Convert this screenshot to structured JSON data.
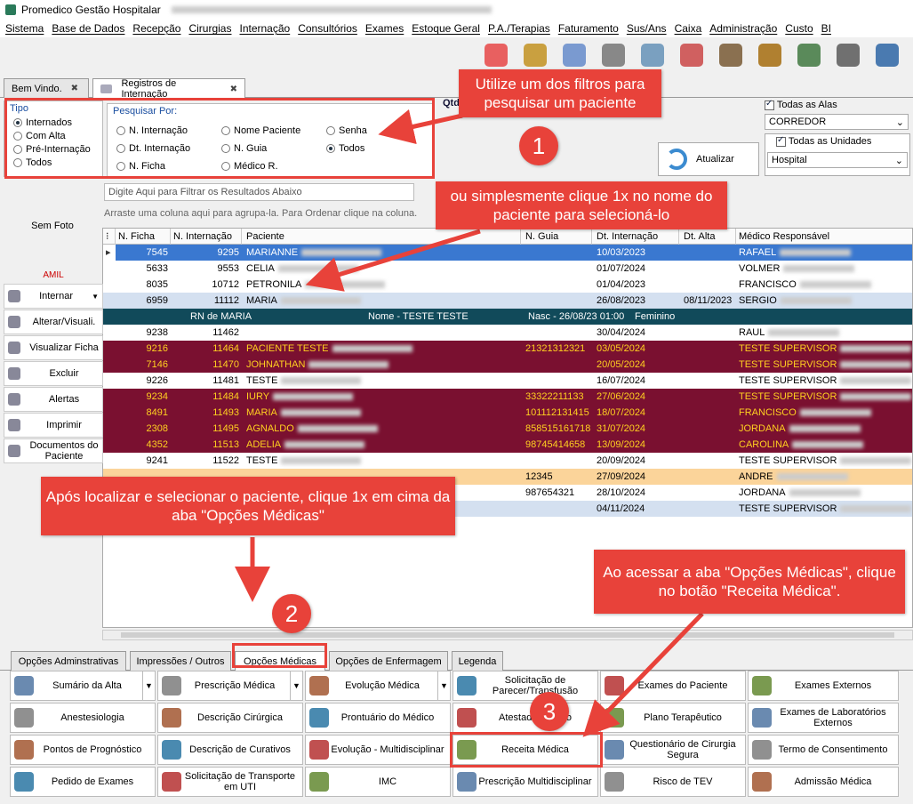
{
  "window": {
    "title": "Promedico Gestão Hospitalar"
  },
  "menu": [
    "Sistema",
    "Base de Dados",
    "Recepção",
    "Cirurgias",
    "Internação",
    "Consultórios",
    "Exames",
    "Estoque Geral",
    "P.A./Terapias",
    "Faturamento",
    "Sus/Ans",
    "Caixa",
    "Administração",
    "Custo",
    "BI"
  ],
  "toolbar_icons": [
    "users-icon",
    "reception-icon",
    "doctor-icon",
    "stethoscope-icon",
    "ambulance-icon",
    "ambulance2-icon",
    "tools-icon",
    "boxes-icon",
    "money-icon",
    "safe-icon",
    "exit-icon"
  ],
  "doc_tabs": [
    "Bem Vindo.",
    "Registros de Internação"
  ],
  "tipo": {
    "title": "Tipo",
    "options": [
      "Internados",
      "Com Alta",
      "Pré-Internação",
      "Todos"
    ],
    "selected": 0
  },
  "pesquisar": {
    "title": "Pesquisar Por:",
    "options": [
      "N. Internação",
      "Nome Paciente",
      "Senha",
      "Dt. Internação",
      "N. Guia",
      "Todos",
      "N. Ficha",
      "Médico R."
    ],
    "selected": "Todos"
  },
  "qtd_label": "Qtd",
  "alas": {
    "checkbox_label": "Todas as Alas",
    "ala_value": "CORREDOR",
    "unidades_label": "Todas as Unidades",
    "unidade_value": "Hospital"
  },
  "atualizar_label": "Atualizar",
  "photo_label": "Sem Foto",
  "filter_placeholder": "Digite Aqui para Filtrar os Resultados Abaixo",
  "grouping_hint": "Arraste uma coluna aqui para agrupa-la. Para Ordenar clique na coluna.",
  "columns": [
    "N. Ficha",
    "N. Internação",
    "Paciente",
    "N. Guia",
    "Dt. Internação",
    "Dt. Alta",
    "Médico Responsável"
  ],
  "rows": [
    {
      "ficha": "7545",
      "intern": "9295",
      "paciente": "MARIANNE",
      "guia": "",
      "dt": "10/03/2023",
      "alta": "",
      "medico": "RAFAEL",
      "style": "sel"
    },
    {
      "ficha": "5633",
      "intern": "9553",
      "paciente": "CELIA",
      "guia": "",
      "dt": "01/07/2024",
      "alta": "",
      "medico": "VOLMER",
      "style": "plain"
    },
    {
      "ficha": "8035",
      "intern": "10712",
      "paciente": "PETRONILA",
      "guia": "",
      "dt": "01/04/2023",
      "alta": "",
      "medico": "FRANCISCO",
      "style": "plain"
    },
    {
      "ficha": "6959",
      "intern": "11112",
      "paciente": "MARIA",
      "guia": "",
      "dt": "26/08/2023",
      "alta": "08/11/2023",
      "medico": "SERGIO",
      "style": "light"
    },
    {
      "ficha": "",
      "intern": "",
      "paciente": "",
      "guia": "",
      "dt": "",
      "alta": "",
      "medico": "",
      "style": "sub",
      "sub": {
        "rn": "RN de MARIA",
        "nome": "Nome - TESTE TESTE",
        "nasc": "Nasc - 26/08/23 01:00",
        "sexo": "Feminino"
      }
    },
    {
      "ficha": "9238",
      "intern": "11462",
      "paciente": "",
      "guia": "",
      "dt": "30/04/2024",
      "alta": "",
      "medico": "RAUL",
      "style": "plain"
    },
    {
      "ficha": "9216",
      "intern": "11464",
      "paciente": "PACIENTE TESTE",
      "guia": "21321312321",
      "dt": "03/05/2024",
      "alta": "",
      "medico": "TESTE SUPERVISOR",
      "style": "dark"
    },
    {
      "ficha": "7146",
      "intern": "11470",
      "paciente": "JOHNATHAN",
      "guia": "",
      "dt": "20/05/2024",
      "alta": "",
      "medico": "TESTE SUPERVISOR",
      "style": "dark"
    },
    {
      "ficha": "9226",
      "intern": "11481",
      "paciente": "TESTE",
      "guia": "",
      "dt": "16/07/2024",
      "alta": "",
      "medico": "TESTE SUPERVISOR",
      "style": "plain"
    },
    {
      "ficha": "9234",
      "intern": "11484",
      "paciente": "IURY",
      "guia": "33322211133",
      "dt": "27/06/2024",
      "alta": "",
      "medico": "TESTE SUPERVISOR",
      "style": "dark"
    },
    {
      "ficha": "8491",
      "intern": "11493",
      "paciente": "MARIA",
      "guia": "101112131415",
      "dt": "18/07/2024",
      "alta": "",
      "medico": "FRANCISCO",
      "style": "dark"
    },
    {
      "ficha": "2308",
      "intern": "11495",
      "paciente": "AGNALDO",
      "guia": "858515161718",
      "dt": "31/07/2024",
      "alta": "",
      "medico": "JORDANA",
      "style": "dark"
    },
    {
      "ficha": "4352",
      "intern": "11513",
      "paciente": "ADELIA",
      "guia": "98745414658",
      "dt": "13/09/2024",
      "alta": "",
      "medico": "CAROLINA",
      "style": "dark"
    },
    {
      "ficha": "9241",
      "intern": "11522",
      "paciente": "TESTE",
      "guia": "",
      "dt": "20/09/2024",
      "alta": "",
      "medico": "TESTE SUPERVISOR",
      "style": "plain"
    },
    {
      "ficha": "",
      "intern": "",
      "paciente": "",
      "guia": "12345",
      "dt": "27/09/2024",
      "alta": "",
      "medico": "ANDRE",
      "style": "orange"
    },
    {
      "ficha": "",
      "intern": "",
      "paciente": "",
      "guia": "987654321",
      "dt": "28/10/2024",
      "alta": "",
      "medico": "JORDANA",
      "style": "plain"
    },
    {
      "ficha": "",
      "intern": "",
      "paciente": "",
      "guia": "",
      "dt": "04/11/2024",
      "alta": "",
      "medico": "TESTE SUPERVISOR",
      "style": "light"
    }
  ],
  "left_tools": {
    "title": "AMIL",
    "buttons": [
      "Internar",
      "Alterar/Visuali.",
      "Visualizar Ficha",
      "Excluir",
      "Alertas",
      "Imprimir",
      "Documentos do Paciente"
    ]
  },
  "option_tabs": [
    "Opções Adminstrativas",
    "Impressões / Outros",
    "Opções Médicas",
    "Opções de Enfermagem",
    "Legenda"
  ],
  "option_buttons": [
    [
      "Sumário da Alta",
      "Prescrição Médica",
      "Evolução Médica",
      "Solicitação de Parecer/Transfusão",
      "Exames do Paciente",
      "Exames Externos"
    ],
    [
      "Anestesiologia",
      "Descrição Cirúrgica",
      "Prontuário do Médico",
      "Atestado Médico",
      "Plano Terapêutico",
      "Exames de Laboratórios Externos"
    ],
    [
      "Pontos de Prognóstico",
      "Descrição de Curativos",
      "Evolução - Multidisciplinar",
      "Receita Médica",
      "Questionário de Cirurgia Segura",
      "Termo de Consentimento"
    ],
    [
      "Pedido de Exames",
      "Solicitação de Transporte em UTI",
      "IMC",
      "Prescrição Multidisciplinar",
      "Risco de TEV",
      "Admissão Médica"
    ]
  ],
  "callouts": {
    "c1": "Utilize um dos filtros para pesquisar um paciente",
    "c2": "ou simplesmente clique 1x no nome do paciente para selecioná-lo",
    "c3": "Após localizar e selecionar o paciente, clique 1x em cima da aba \"Opções Médicas\"",
    "c4": "Ao acessar a aba \"Opções Médicas\", clique no botão \"Receita Médica\".",
    "n1": "1",
    "n2": "2",
    "n3": "3"
  }
}
